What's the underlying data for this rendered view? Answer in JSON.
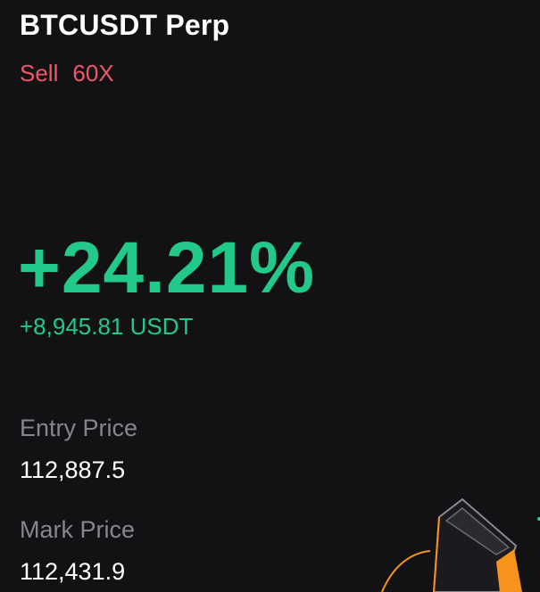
{
  "position": {
    "pair": "BTCUSDT Perp",
    "side": "Sell",
    "leverage": "60X"
  },
  "pnl": {
    "percent": "+24.21%",
    "amount": "+8,945.81 USDT"
  },
  "prices": {
    "entry_label": "Entry Price",
    "entry_value": "112,887.5",
    "mark_label": "Mark Price",
    "mark_value": "112,431.9"
  },
  "colors": {
    "background": "#121215",
    "sell": "#f0566a",
    "profit": "#22c98b",
    "muted_label": "#87878b",
    "accent_orange": "#f7931a"
  },
  "decoration": {
    "icon": "crypto-cube-graphic-icon"
  }
}
